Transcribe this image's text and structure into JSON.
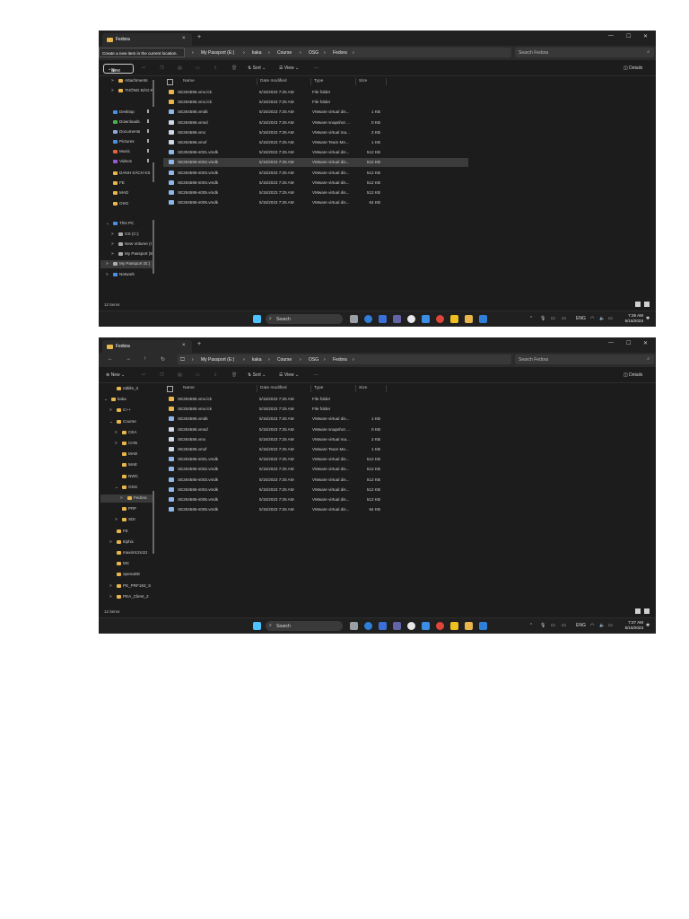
{
  "window": {
    "tab_title": "Fedora",
    "new_tab_symbol": "+",
    "close_tab_symbol": "×",
    "controls": [
      "—",
      "☐",
      "✕"
    ]
  },
  "address": {
    "breadcrumbs": [
      "My Passport (E:)",
      "kaka",
      "Course",
      "OSG",
      "Fedora"
    ],
    "search_placeholder": "Search Fedora"
  },
  "tooltip": "Create a new item in the current location.",
  "toolbar": {
    "new_label": "New",
    "sort_label": "Sort",
    "view_label": "View",
    "more_label": "···",
    "details_label": "Details"
  },
  "columns": [
    "Name",
    "Date modified",
    "Type",
    "Size"
  ],
  "files": [
    {
      "name": "SE284586.vmx.lck",
      "date": "5/15/2023 7:25 AM",
      "type": "File folder",
      "size": "",
      "kind": "folder"
    },
    {
      "name": "SE284586.vmx.lck",
      "date": "5/15/2023 7:25 AM",
      "type": "File folder",
      "size": "",
      "kind": "folder"
    },
    {
      "name": "SE284586.vmdk",
      "date": "5/15/2023 7:25 AM",
      "type": "VMware virtual dis...",
      "size": "1 KB",
      "kind": "disk"
    },
    {
      "name": "SE284586.vmsd",
      "date": "5/15/2023 7:25 AM",
      "type": "VMware snapshot ...",
      "size": "0 KB",
      "kind": "doc"
    },
    {
      "name": "SE284586.vmx",
      "date": "5/15/2023 7:25 AM",
      "type": "VMware virtual ma...",
      "size": "2 KB",
      "kind": "vmx"
    },
    {
      "name": "SE284586.vmxf",
      "date": "5/15/2023 7:25 AM",
      "type": "VMware Team Me...",
      "size": "1 KB",
      "kind": "doc"
    },
    {
      "name": "SE284586-s001.vmdk",
      "date": "5/15/2023 7:25 AM",
      "type": "VMware virtual dis...",
      "size": "512 KB",
      "kind": "disk"
    },
    {
      "name": "SE284586-s002.vmdk",
      "date": "5/15/2023 7:25 AM",
      "type": "VMware virtual dis...",
      "size": "512 KB",
      "kind": "disk"
    },
    {
      "name": "SE284586-s003.vmdk",
      "date": "5/15/2023 7:25 AM",
      "type": "VMware virtual dis...",
      "size": "512 KB",
      "kind": "disk"
    },
    {
      "name": "SE284586-s004.vmdk",
      "date": "5/15/2023 7:25 AM",
      "type": "VMware virtual dis...",
      "size": "512 KB",
      "kind": "disk"
    },
    {
      "name": "SE284586-s005.vmdk",
      "date": "5/15/2023 7:25 AM",
      "type": "VMware virtual dis...",
      "size": "512 KB",
      "kind": "disk"
    },
    {
      "name": "SE284586-s006.vmdk",
      "date": "5/15/2023 7:25 AM",
      "type": "VMware virtual dis...",
      "size": "64 KB",
      "kind": "disk"
    }
  ],
  "sidebar1": [
    {
      "label": "Attachments",
      "icon": "folder",
      "level": 1,
      "chev": ">"
    },
    {
      "label": "THÔNG BÁO K",
      "icon": "folder",
      "level": 1,
      "chev": ">"
    },
    {
      "label": "Desktop",
      "icon": "desktop",
      "level": 0,
      "chev": "",
      "pin": true
    },
    {
      "label": "Downloads",
      "icon": "download",
      "level": 0,
      "chev": "",
      "pin": true
    },
    {
      "label": "Documents",
      "icon": "documents",
      "level": 0,
      "chev": "",
      "pin": true
    },
    {
      "label": "Pictures",
      "icon": "pictures",
      "level": 0,
      "chev": "",
      "pin": true
    },
    {
      "label": "Music",
      "icon": "music",
      "level": 0,
      "chev": "",
      "pin": true
    },
    {
      "label": "Videos",
      "icon": "videos",
      "level": 0,
      "chev": "",
      "pin": true
    },
    {
      "label": "DANH SÁCH KS",
      "icon": "folder",
      "level": 0,
      "chev": ""
    },
    {
      "label": "FE",
      "icon": "folder",
      "level": 0,
      "chev": ""
    },
    {
      "label": "MAD",
      "icon": "folder",
      "level": 0,
      "chev": ""
    },
    {
      "label": "OSG",
      "icon": "folder",
      "level": 0,
      "chev": ""
    },
    {
      "label": "This PC",
      "icon": "pc",
      "level": 0,
      "chev": "⌄"
    },
    {
      "label": "OS (C:)",
      "icon": "drive",
      "level": 1,
      "chev": ">"
    },
    {
      "label": "New Volume (I",
      "icon": "drive",
      "level": 1,
      "chev": ">"
    },
    {
      "label": "My Passport (E",
      "icon": "drive",
      "level": 1,
      "chev": ">"
    },
    {
      "label": "My Passport (E:)",
      "icon": "drive",
      "level": 0,
      "chev": ">",
      "sel": true
    },
    {
      "label": "Network",
      "icon": "network",
      "level": 0,
      "chev": ">"
    }
  ],
  "sidebar2": [
    {
      "label": "ndtiile_3",
      "level": 1,
      "chev": ""
    },
    {
      "label": "kaka",
      "level": 0,
      "chev": "⌄"
    },
    {
      "label": "C++",
      "level": 1,
      "chev": ">"
    },
    {
      "label": "Course",
      "level": 1,
      "chev": "⌄"
    },
    {
      "label": "CEA",
      "level": 2,
      "chev": ">"
    },
    {
      "label": "CHN",
      "level": 2,
      "chev": ">"
    },
    {
      "label": "MAD",
      "level": 2,
      "chev": ""
    },
    {
      "label": "MAE",
      "level": 2,
      "chev": ""
    },
    {
      "label": "NWC",
      "level": 2,
      "chev": ""
    },
    {
      "label": "OSG",
      "level": 2,
      "chev": "⌄"
    },
    {
      "label": "Fedora",
      "level": 3,
      "chev": ">",
      "sel": true
    },
    {
      "label": "PRF",
      "level": 2,
      "chev": ""
    },
    {
      "label": "SDI",
      "level": 2,
      "chev": ">"
    },
    {
      "label": "FE",
      "level": 1,
      "chev": ""
    },
    {
      "label": "Itiphic",
      "level": 1,
      "chev": ">"
    },
    {
      "label": "maxim12x11t",
      "level": 1,
      "chev": ""
    },
    {
      "label": "MC",
      "level": 1,
      "chev": ""
    },
    {
      "label": "openaDE",
      "level": 1,
      "chev": ""
    },
    {
      "label": "PE_PRF193_S",
      "level": 1,
      "chev": ">"
    },
    {
      "label": "PEA_Client_2",
      "level": 1,
      "chev": ">"
    }
  ],
  "status1": "12 items",
  "status2": "12 items",
  "taskbar": {
    "search_label": "Search",
    "lang": "ENG",
    "time1": "7:26 AM",
    "date1": "5/15/2023",
    "time2": "7:27 AM",
    "date2": "5/15/2023"
  },
  "colors": {
    "folder": "#e8b64a",
    "disk": "#8fb8e8",
    "doc": "#cfd8e8",
    "accent": "#4cc2ff"
  }
}
